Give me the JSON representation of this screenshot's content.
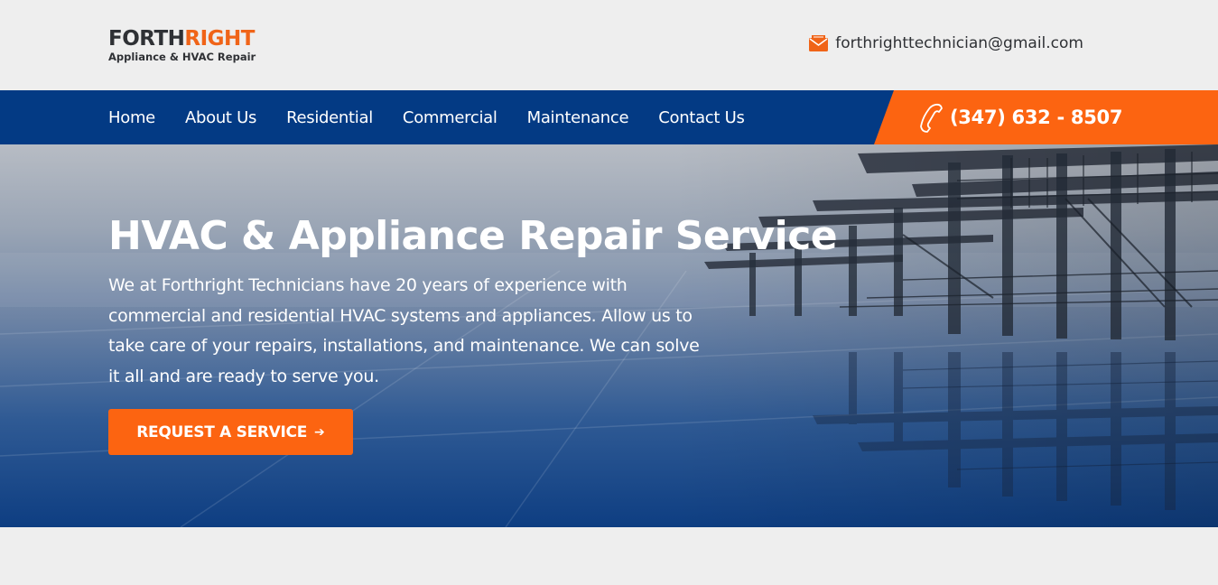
{
  "header": {
    "logo": {
      "main_left": "FORTH",
      "main_right": "RIGHT",
      "sub": "Appliance & HVAC Repair"
    },
    "email": {
      "icon": "envelope-icon",
      "text": "forthrighttechnician@gmail.com"
    }
  },
  "nav": {
    "items": [
      {
        "label": "Home"
      },
      {
        "label": "About Us"
      },
      {
        "label": "Residential"
      },
      {
        "label": "Commercial"
      },
      {
        "label": "Maintenance"
      },
      {
        "label": "Contact Us"
      }
    ],
    "phone": {
      "icon": "phone-icon",
      "text": "(347) 632 - 8507"
    }
  },
  "hero": {
    "title": "HVAC & Appliance Repair Service",
    "description": "We at Forthright Technicians have 20 years of experience with commercial and residential HVAC systems and appliances. Allow us to take care of your repairs, installations, and maintenance. We can solve it all and are ready to serve you.",
    "cta": {
      "label": "REQUEST A SERVICE",
      "arrow": "➔"
    }
  },
  "colors": {
    "brand_blue": "#033a84",
    "brand_orange": "#fc6411",
    "text_dark": "#2f3135",
    "page_bg": "#eeeeee"
  }
}
